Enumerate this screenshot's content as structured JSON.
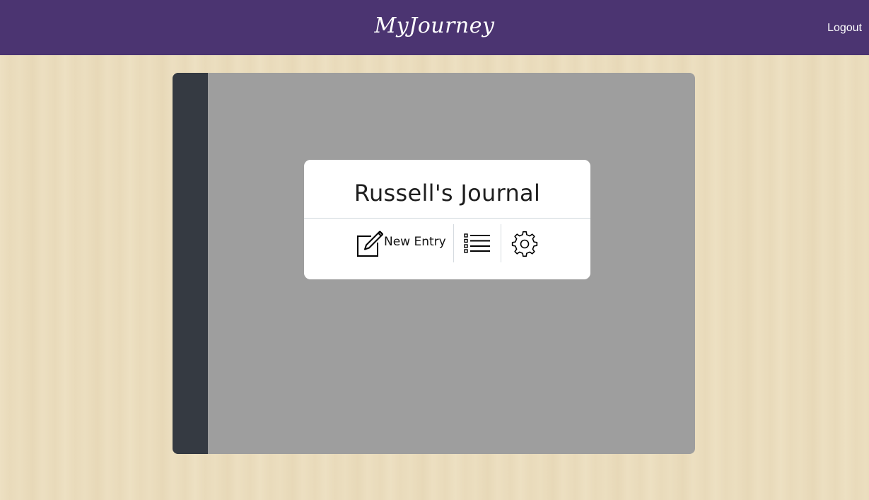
{
  "navbar": {
    "brand": "MyJourney",
    "logout_label": "Logout",
    "background_color": "#4b3471"
  },
  "journal": {
    "title": "Russell's Journal",
    "new_entry_label": "New Entry",
    "icons": [
      "edit-icon",
      "list-icon",
      "gear-icon"
    ],
    "cover_color": "#9e9e9e",
    "spine_color": "#353a42"
  }
}
